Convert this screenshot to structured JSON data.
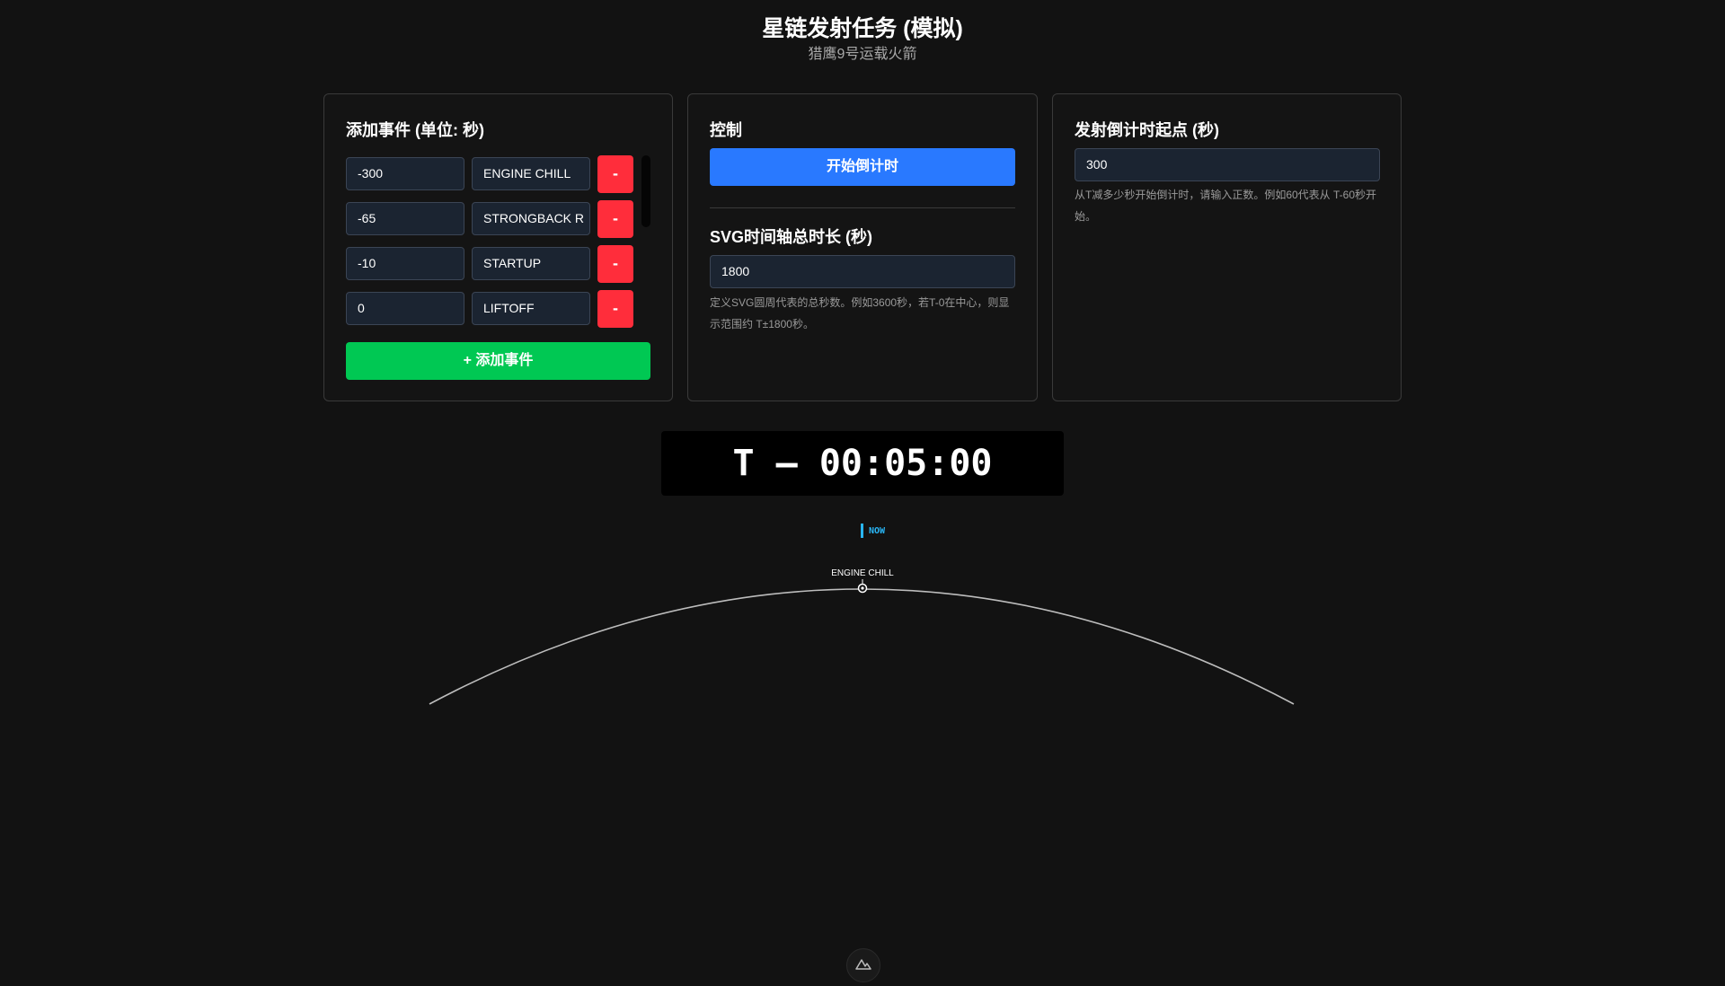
{
  "header": {
    "title": "星链发射任务 (模拟)",
    "subtitle": "猎鹰9号运载火箭"
  },
  "events_panel": {
    "title": "添加事件 (单位: 秒)",
    "events": [
      {
        "time": "-300",
        "name": "ENGINE CHILL",
        "remove_label": "-"
      },
      {
        "time": "-65",
        "name": "STRONGBACK R",
        "remove_label": "-"
      },
      {
        "time": "-10",
        "name": "STARTUP",
        "remove_label": "-"
      },
      {
        "time": "0",
        "name": "LIFTOFF",
        "remove_label": "-"
      }
    ],
    "add_label": "+ 添加事件"
  },
  "control_panel": {
    "title": "控制",
    "start_label": "开始倒计时",
    "duration_title": "SVG时间轴总时长 (秒)",
    "duration_value": "1800",
    "duration_help": "定义SVG圆周代表的总秒数。例如3600秒，若T-0在中心，则显示范围约 T±1800秒。"
  },
  "countdown_panel": {
    "title": "发射倒计时起点 (秒)",
    "start_value": "300",
    "help": "从T减多少秒开始倒计时，请输入正数。例如60代表从 T-60秒开始。"
  },
  "clock": {
    "display": "T – 00:05:00"
  },
  "timeline": {
    "now_label": "NOW",
    "events_visible": [
      {
        "name": "ENGINE CHILL"
      }
    ]
  },
  "colors": {
    "background": "#121212",
    "accent_blue": "#2979ff",
    "accent_green": "#00c853",
    "danger_red": "#ff2d3b",
    "now_cyan": "#29b6f6"
  },
  "icons": [
    "mountain-logo-icon"
  ]
}
